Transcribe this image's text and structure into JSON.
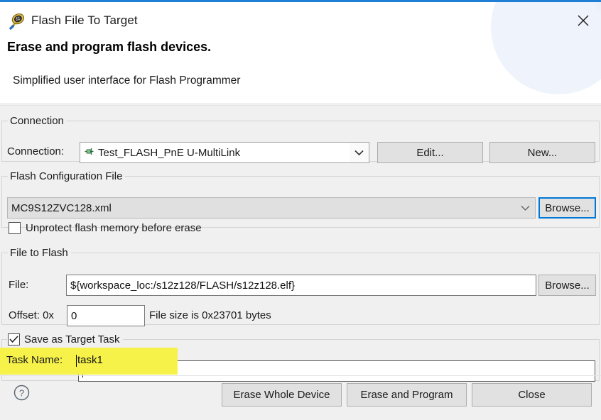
{
  "window": {
    "title": "Flash File To Target",
    "icon": "flash-programmer-icon",
    "close_label": "×",
    "accent_color": "#1f7fd4"
  },
  "header": {
    "title": "Erase and program flash devices.",
    "subtitle": "Simplified user interface for Flash Programmer"
  },
  "connection": {
    "group_label": "Connection",
    "field_label": "Connection:",
    "value": "Test_FLASH_PnE U-MultiLink",
    "value_icon": "connection-node-icon",
    "edit_label": "Edit...",
    "new_label": "New..."
  },
  "flash_config": {
    "group_label": "Flash Configuration File",
    "value": "MC9S12ZVC128.xml",
    "browse_label": "Browse...",
    "unprotect_label": "Unprotect flash memory before erase",
    "unprotect_checked": false
  },
  "file_to_flash": {
    "group_label": "File to Flash",
    "file_label": "File:",
    "file_value": "${workspace_loc:/s12z128/FLASH/s12z128.elf}",
    "browse_label": "Browse...",
    "offset_label": "Offset: 0x",
    "offset_value": "0",
    "file_size_text": "File size is 0x23701 bytes"
  },
  "target_task": {
    "group_label": "Save as Target Task",
    "checked": true,
    "task_name_label": "Task Name:",
    "task_name_value": "task1",
    "highlight_color": "#f7f24a"
  },
  "footer": {
    "help_label": "?",
    "erase_whole_device_label": "Erase Whole Device",
    "erase_and_program_label": "Erase and Program",
    "close_label": "Close"
  }
}
